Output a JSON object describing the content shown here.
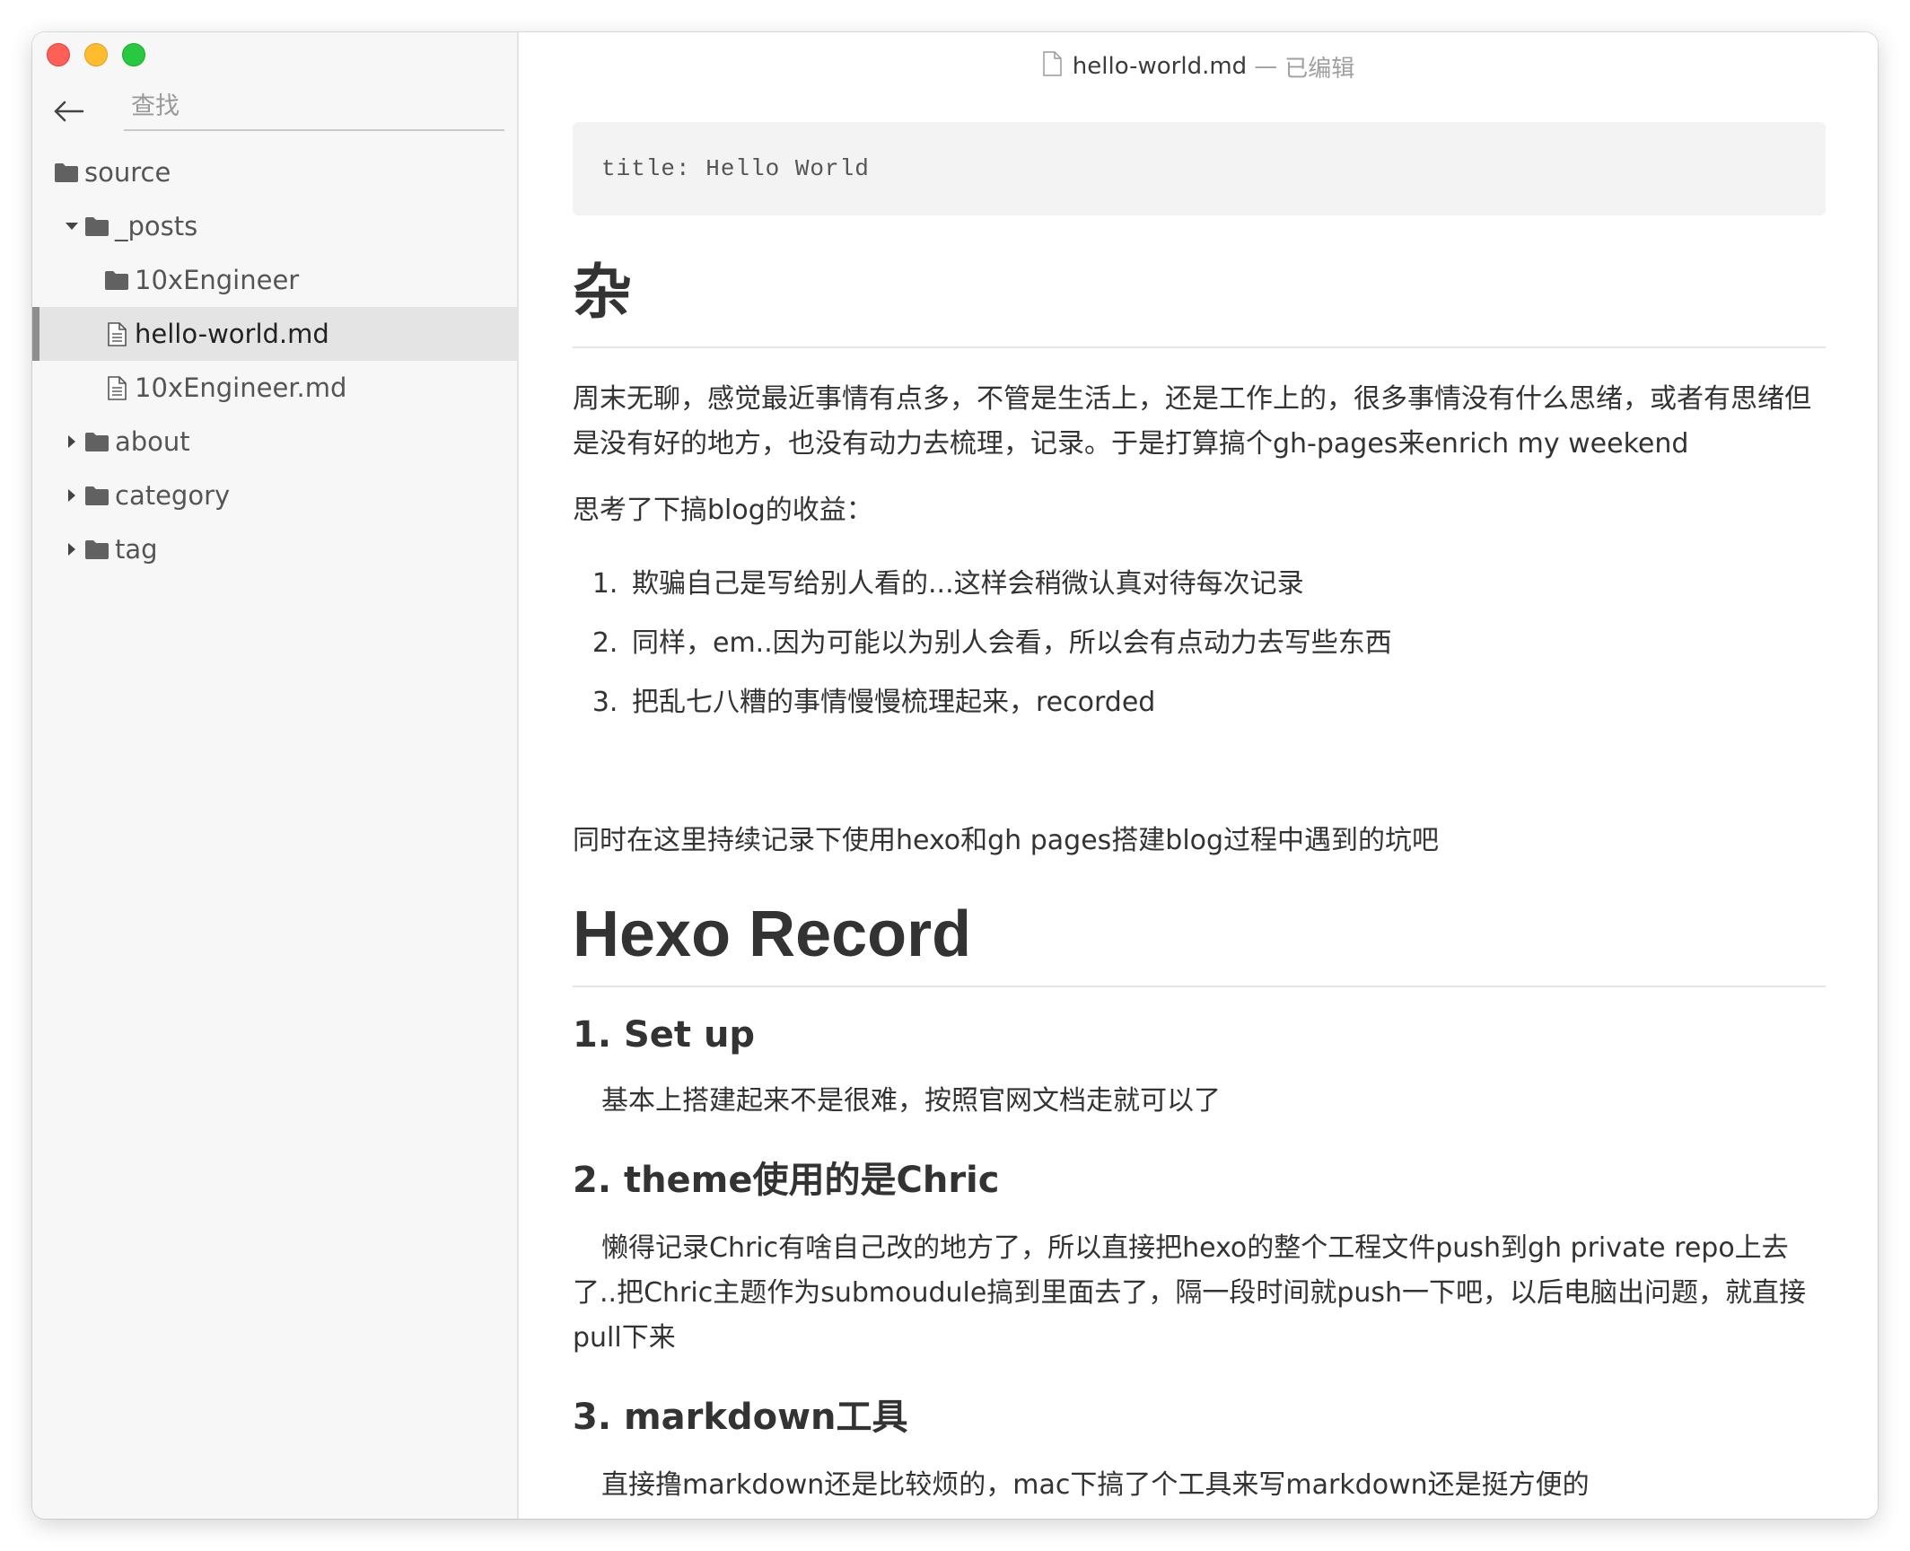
{
  "window": {
    "title": "hello-world.md",
    "title_separator": "—",
    "edited_label": "已编辑"
  },
  "search": {
    "placeholder": "查找",
    "value": ""
  },
  "tree": [
    {
      "label": "source",
      "icon": "folder-icon",
      "type": "folder",
      "expander": "none",
      "level": 0
    },
    {
      "label": "_posts",
      "icon": "folder-icon",
      "type": "folder",
      "expander": "expanded",
      "level": 1
    },
    {
      "label": "10xEngineer",
      "icon": "folder-icon",
      "type": "folder",
      "expander": "none",
      "level": 2
    },
    {
      "label": "hello-world.md",
      "icon": "file-icon",
      "type": "file",
      "expander": "none",
      "level": 2,
      "active": true
    },
    {
      "label": "10xEngineer.md",
      "icon": "file-icon",
      "type": "file",
      "expander": "none",
      "level": 2
    },
    {
      "label": "about",
      "icon": "folder-icon",
      "type": "folder",
      "expander": "collapsed",
      "level": 1
    },
    {
      "label": "category",
      "icon": "folder-icon",
      "type": "folder",
      "expander": "collapsed",
      "level": 1
    },
    {
      "label": "tag",
      "icon": "folder-icon",
      "type": "folder",
      "expander": "collapsed",
      "level": 1
    }
  ],
  "doc": {
    "frontmatter": "title: Hello World",
    "h1_za": "杂",
    "p1": "周末无聊，感觉最近事情有点多，不管是生活上，还是工作上的，很多事情没有什么思绪，或者有思绪但是没有好的地方，也没有动力去梳理，记录。于是打算搞个gh-pages来enrich my weekend",
    "p2": "思考了下搞blog的收益：",
    "list": [
      "欺骗自己是写给别人看的...这样会稍微认真对待每次记录",
      "同样，em..因为可能以为别人会看，所以会有点动力去写些东西",
      "把乱七八糟的事情慢慢梳理起来，recorded"
    ],
    "p3": "同时在这里持续记录下使用hexo和gh pages搭建blog过程中遇到的坑吧",
    "h1_hexo": "Hexo Record",
    "h3_setup": "1. Set up",
    "p_setup": "基本上搭建起来不是很难，按照官网文档走就可以了",
    "h3_theme": "2. theme使用的是Chric",
    "p_theme": "懒得记录Chric有啥自己改的地方了，所以直接把hexo的整个工程文件push到gh private repo上去了..把Chric主题作为submoudule搞到里面去了，隔一段时间就push一下吧，以后电脑出问题，就直接pull下来",
    "h3_md": "3. markdown工具",
    "p_md": "直接撸markdown还是比较烦的，mac下搞了个工具来写markdown还是挺方便的"
  },
  "colors": {
    "sidebar_bg": "#f7f7f7",
    "active_item_bg": "#e4e4e4",
    "frontmatter_bg": "#f3f3f3",
    "text": "#333333",
    "close": "#fe5f57",
    "minimize": "#febc2e",
    "zoom": "#28c840"
  }
}
